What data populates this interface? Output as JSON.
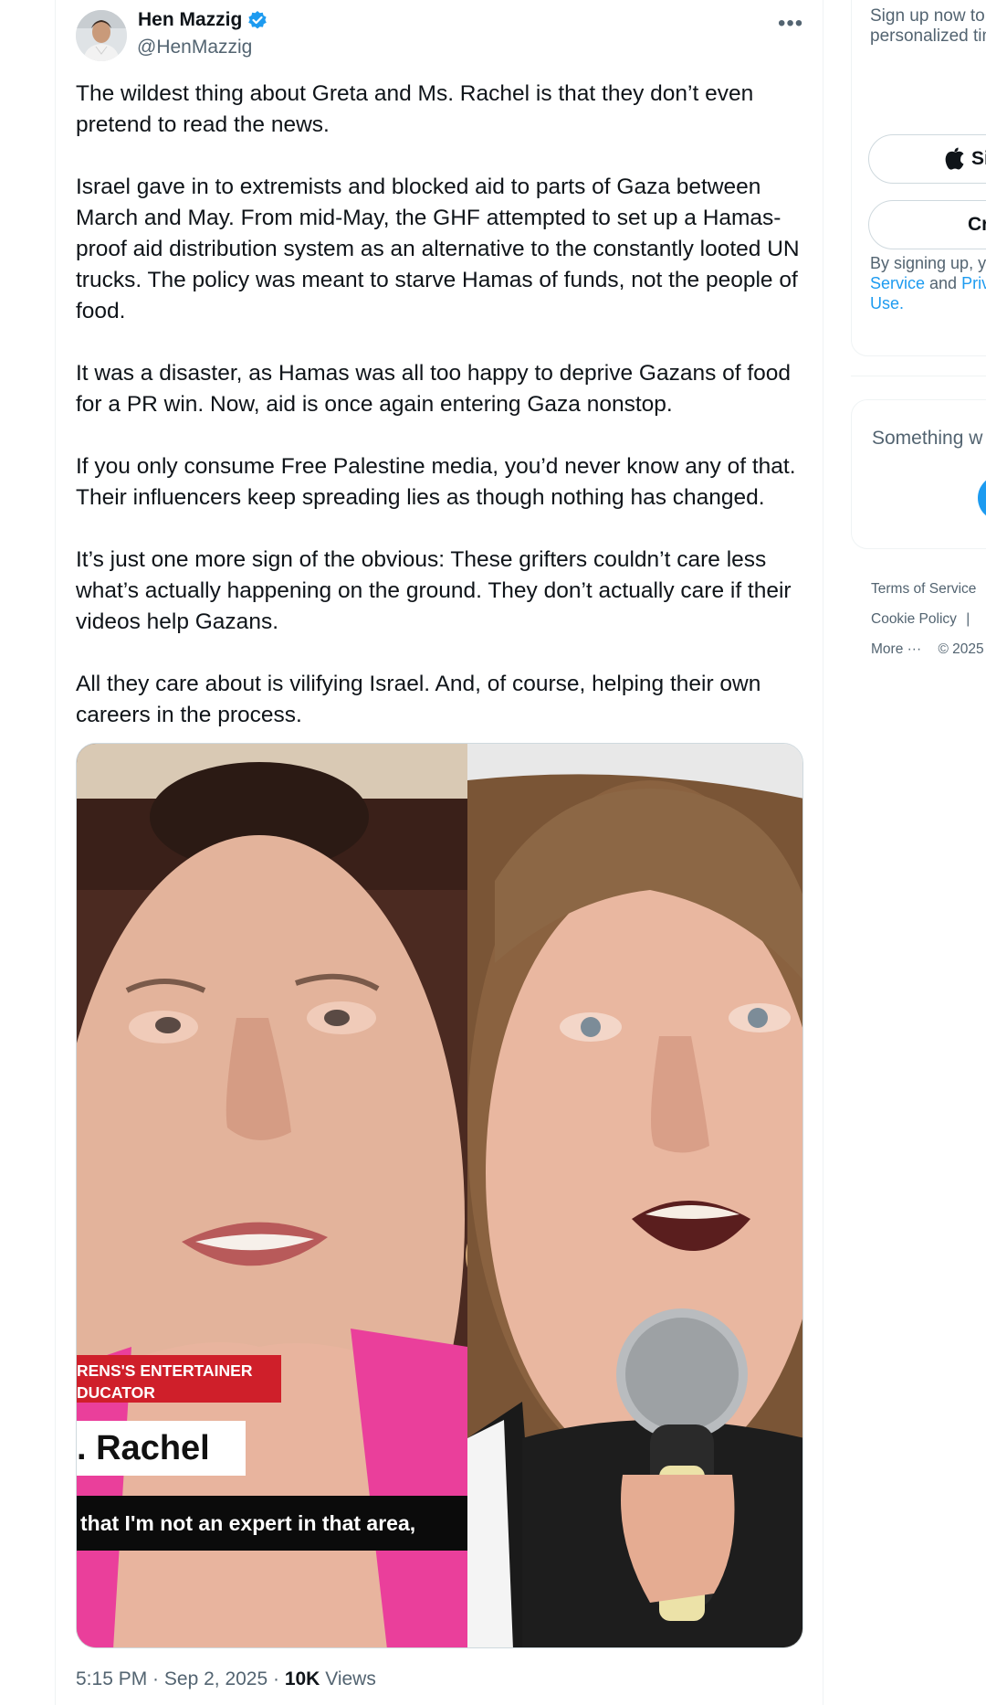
{
  "tweet": {
    "author_name": "Hen Mazzig",
    "author_handle": "@HenMazzig",
    "more_icon": "ellipsis-icon",
    "paragraphs": [
      "The wildest thing about Greta and Ms. Rachel is that they don’t even pretend to read the news.",
      "Israel gave in to extremists and blocked aid to parts of Gaza between March and May. From mid-May, the GHF attempted to set up a Hamas-proof aid distribution system as an alternative to the constantly looted UN trucks. The policy was meant to starve Hamas of funds, not the people of food.",
      "It was a disaster, as Hamas was all too happy to deprive Gazans of food for a PR win. Now, aid is once again entering Gaza nonstop.",
      "If you only consume Free Palestine media, you’d never know any of that. Their influencers keep spreading lies as though nothing has changed.",
      "It’s just one more sign of the obvious: These grifters couldn’t care less what’s actually happening on the ground. They don’t actually care if their videos help Gazans.",
      "All they care about is vilifying Israel. And, of course, helping their own careers in the process."
    ],
    "media": {
      "caption_red_line1": "RENS'S ENTERTAINER",
      "caption_red_line2": "DUCATOR",
      "caption_name": ". Rachel",
      "caption_subtitle": "that I'm not an expert in that area,"
    },
    "time": "5:15 PM",
    "date": "Sep 2, 2025",
    "views_count": "10K",
    "views_label": "Views"
  },
  "sidebar": {
    "signup_text": "Sign up now to get your own personalized timeline!",
    "apple_button": "Si",
    "create_button": "Cr",
    "terms_prefix": "By signing up, y",
    "terms_link1": "Service",
    "terms_and": " and ",
    "terms_link2": "Priv",
    "terms_link3": "Use.",
    "error_title": "Something w",
    "footer": {
      "terms": "Terms of Service",
      "cookie": "Cookie Policy",
      "cookie_sep": "|",
      "more": "More",
      "copyright": "© 2025"
    }
  },
  "colors": {
    "accent": "#1d9bf0",
    "text": "#0f1419",
    "muted": "#536471",
    "border": "#eff3f4"
  }
}
